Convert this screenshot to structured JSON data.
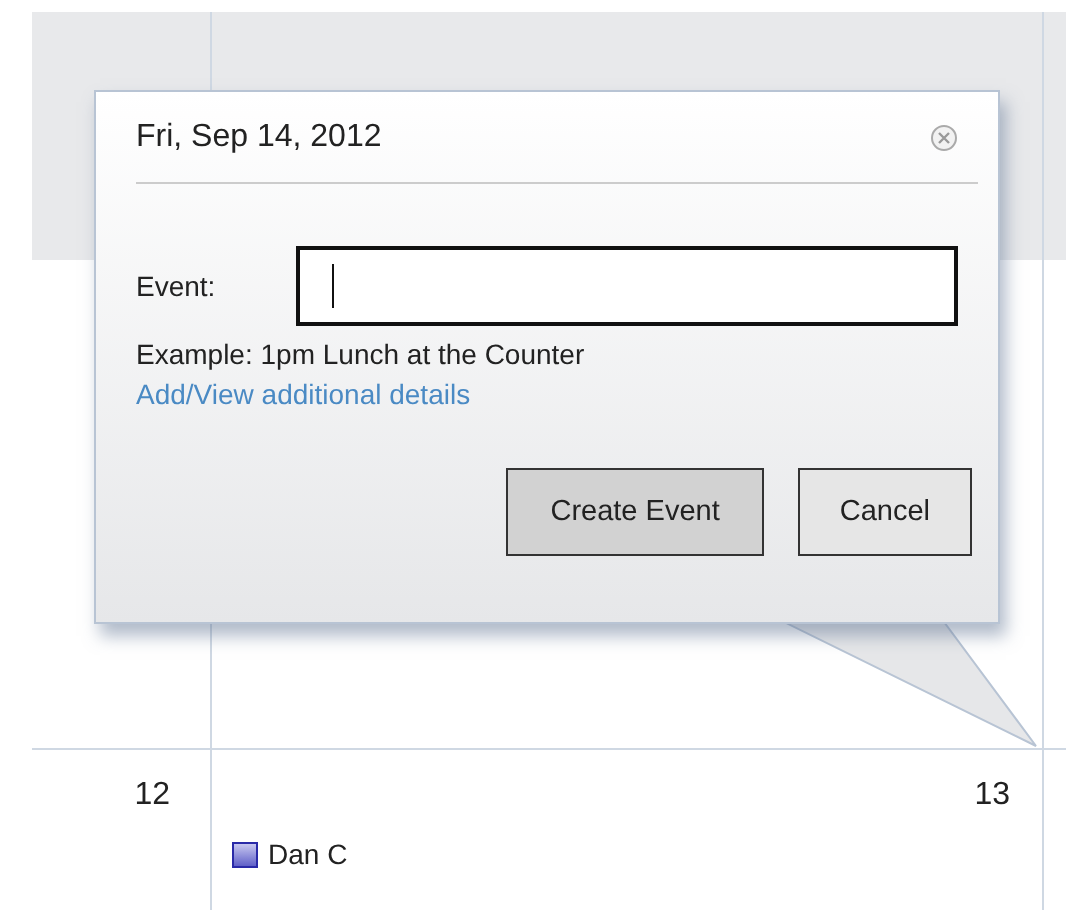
{
  "calendar": {
    "days": [
      {
        "number": "12"
      },
      {
        "number": "13"
      }
    ],
    "events": [
      {
        "title": "Dan C"
      }
    ]
  },
  "popup": {
    "title": "Fri, Sep 14, 2012",
    "field": {
      "label": "Event:"
    },
    "example": "Example: 1pm Lunch at the Counter",
    "link": "Add/View additional details",
    "buttons": [
      {
        "label": "Create Event",
        "default": true
      },
      {
        "label": "Cancel",
        "default": false
      }
    ]
  }
}
